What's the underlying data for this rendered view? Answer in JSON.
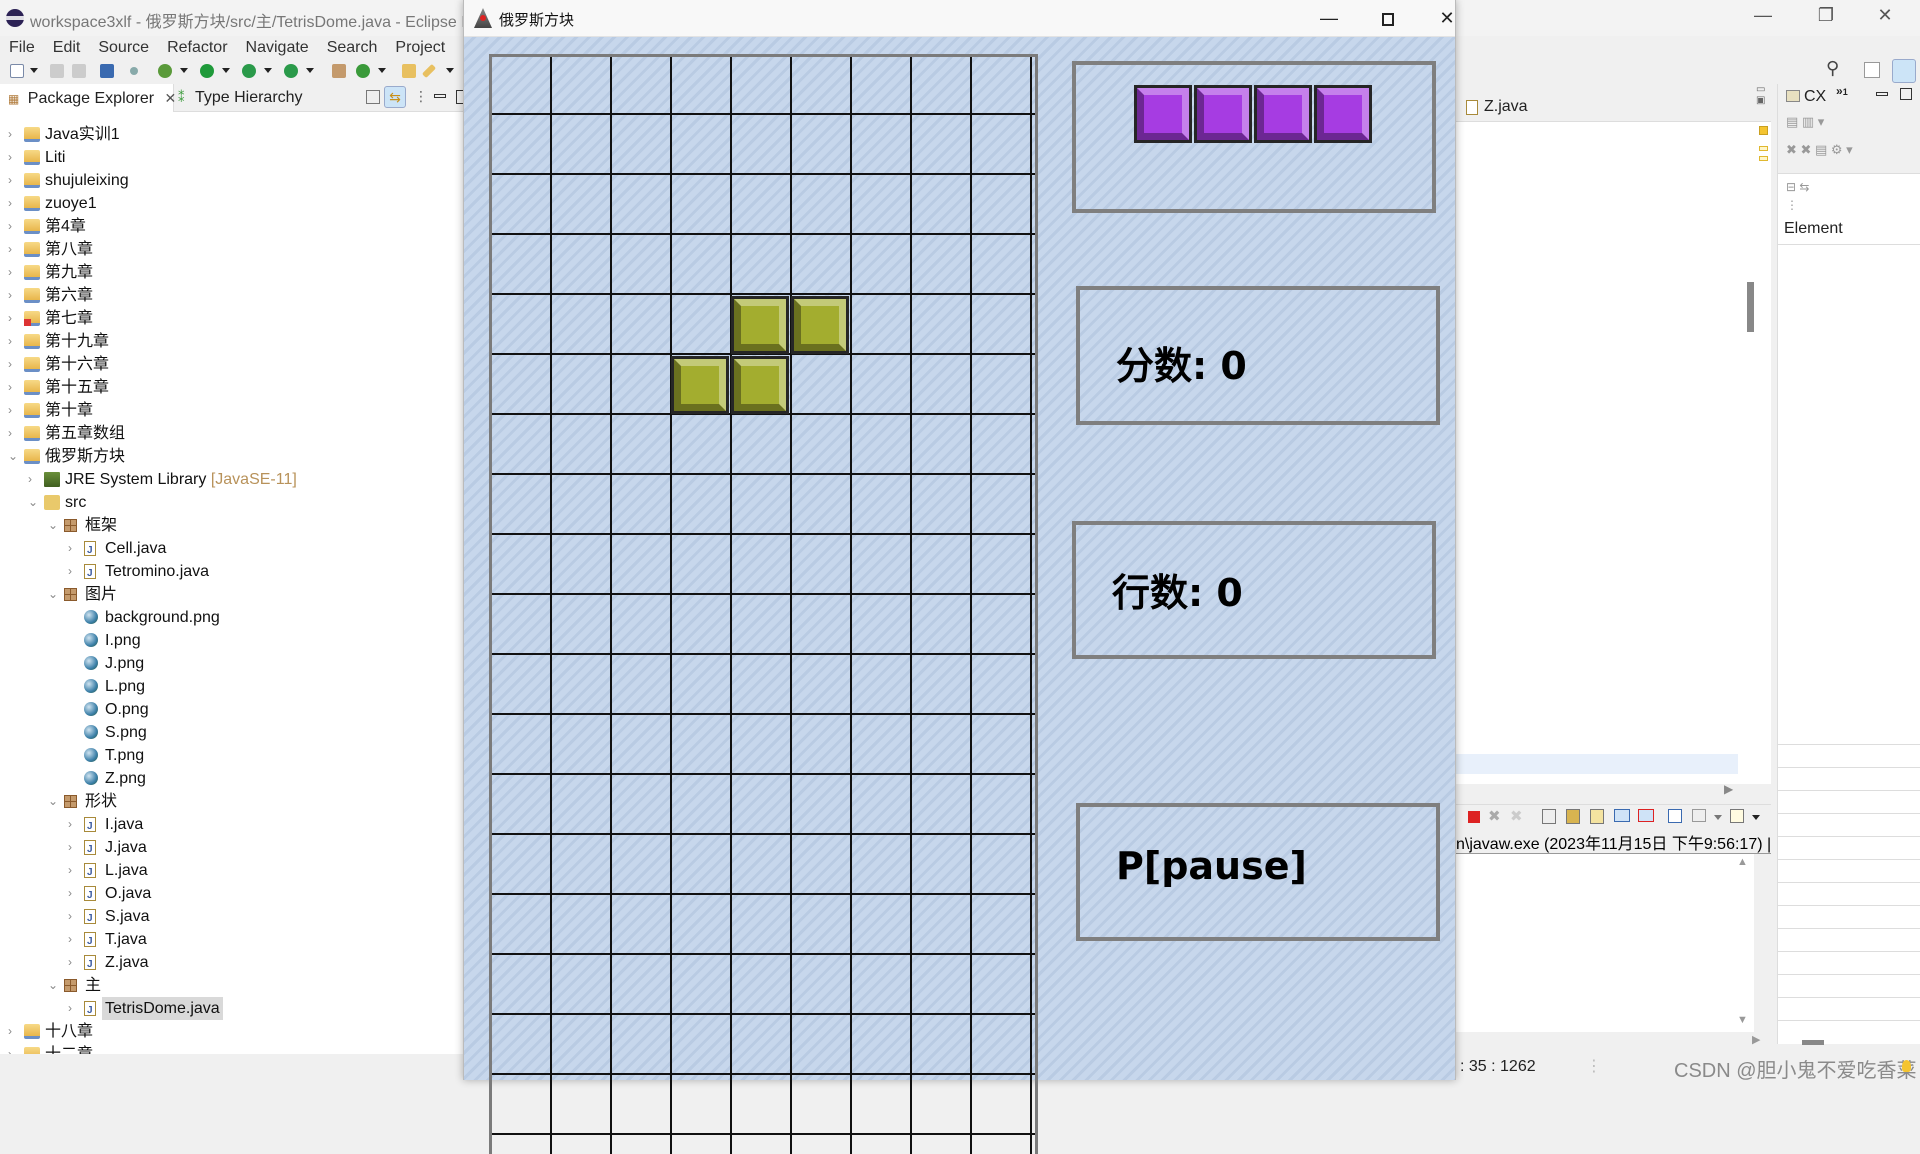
{
  "eclipse": {
    "window_title": "workspace3xlf - 俄罗斯方块/src/主/TetrisDome.java - Eclipse IDE",
    "menu": [
      "File",
      "Edit",
      "Source",
      "Refactor",
      "Navigate",
      "Search",
      "Project"
    ],
    "views": {
      "package_explorer_tab": "Package Explorer",
      "type_hierarchy_tab": "Type Hierarchy"
    },
    "tree": [
      {
        "label": "Java实训1",
        "level": 0,
        "type": "project",
        "expanded": false
      },
      {
        "label": "Liti",
        "level": 0,
        "type": "project",
        "expanded": false
      },
      {
        "label": "shujuleixing",
        "level": 0,
        "type": "project",
        "expanded": false
      },
      {
        "label": "zuoye1",
        "level": 0,
        "type": "project",
        "expanded": false
      },
      {
        "label": "第4章",
        "level": 0,
        "type": "project",
        "expanded": false
      },
      {
        "label": "第八章",
        "level": 0,
        "type": "project",
        "expanded": false
      },
      {
        "label": "第九章",
        "level": 0,
        "type": "project",
        "expanded": false
      },
      {
        "label": "第六章",
        "level": 0,
        "type": "project",
        "expanded": false
      },
      {
        "label": "第七章",
        "level": 0,
        "type": "project-error",
        "expanded": false
      },
      {
        "label": "第十九章",
        "level": 0,
        "type": "project",
        "expanded": false
      },
      {
        "label": "第十六章",
        "level": 0,
        "type": "project",
        "expanded": false
      },
      {
        "label": "第十五章",
        "level": 0,
        "type": "project",
        "expanded": false
      },
      {
        "label": "第十章",
        "level": 0,
        "type": "project",
        "expanded": false
      },
      {
        "label": "第五章数组",
        "level": 0,
        "type": "project",
        "expanded": false
      },
      {
        "label": "俄罗斯方块",
        "level": 0,
        "type": "project",
        "expanded": true
      },
      {
        "label": "JRE System Library",
        "decoration": "[JavaSE-11]",
        "level": 1,
        "type": "jre",
        "expanded": false
      },
      {
        "label": "src",
        "level": 1,
        "type": "src",
        "expanded": true
      },
      {
        "label": "框架",
        "level": 2,
        "type": "package",
        "expanded": true
      },
      {
        "label": "Cell.java",
        "level": 3,
        "type": "java",
        "expanded": false
      },
      {
        "label": "Tetromino.java",
        "level": 3,
        "type": "java",
        "expanded": false
      },
      {
        "label": "图片",
        "level": 2,
        "type": "package",
        "expanded": true
      },
      {
        "label": "background.png",
        "level": 3,
        "type": "png"
      },
      {
        "label": "I.png",
        "level": 3,
        "type": "png"
      },
      {
        "label": "J.png",
        "level": 3,
        "type": "png"
      },
      {
        "label": "L.png",
        "level": 3,
        "type": "png"
      },
      {
        "label": "O.png",
        "level": 3,
        "type": "png"
      },
      {
        "label": "S.png",
        "level": 3,
        "type": "png"
      },
      {
        "label": "T.png",
        "level": 3,
        "type": "png"
      },
      {
        "label": "Z.png",
        "level": 3,
        "type": "png"
      },
      {
        "label": "形状",
        "level": 2,
        "type": "package",
        "expanded": true
      },
      {
        "label": "I.java",
        "level": 3,
        "type": "java",
        "expanded": false
      },
      {
        "label": "J.java",
        "level": 3,
        "type": "java",
        "expanded": false
      },
      {
        "label": "L.java",
        "level": 3,
        "type": "java",
        "expanded": false
      },
      {
        "label": "O.java",
        "level": 3,
        "type": "java",
        "expanded": false
      },
      {
        "label": "S.java",
        "level": 3,
        "type": "java",
        "expanded": false
      },
      {
        "label": "T.java",
        "level": 3,
        "type": "java",
        "expanded": false
      },
      {
        "label": "Z.java",
        "level": 3,
        "type": "java",
        "expanded": false
      },
      {
        "label": "主",
        "level": 2,
        "type": "package",
        "expanded": true
      },
      {
        "label": "TetrisDome.java",
        "level": 3,
        "type": "java",
        "expanded": false,
        "selected": true
      },
      {
        "label": "十八章",
        "level": 0,
        "type": "project",
        "expanded": false
      },
      {
        "label": "十二章",
        "level": 0,
        "type": "project",
        "expanded": false
      }
    ],
    "editor_tab": "Z.java",
    "outline": {
      "tab_label": "CX",
      "overflow_count": "1",
      "column_header": "Element"
    },
    "console_header": "n\\javaw.exe  (2023年11月15日 下午9:56:17) |",
    "status_position": ": 35 : 1262",
    "watermark": "CSDN @胆小鬼不爱吃香菜"
  },
  "tetris": {
    "window_title": "俄罗斯方块",
    "board": {
      "columns": 9,
      "visible_rows": 17,
      "current_piece": {
        "shape": "S",
        "color": "#a3ad2f",
        "cells": [
          [
            4,
            4
          ],
          [
            5,
            4
          ],
          [
            3,
            5
          ],
          [
            4,
            5
          ]
        ]
      }
    },
    "next_piece": {
      "shape": "I",
      "color": "#a63ce2",
      "cells": 4
    },
    "score_label": "分数: 0",
    "score": 0,
    "lines_label": "行数: 0",
    "lines": 0,
    "pause_label": "P[pause]"
  }
}
